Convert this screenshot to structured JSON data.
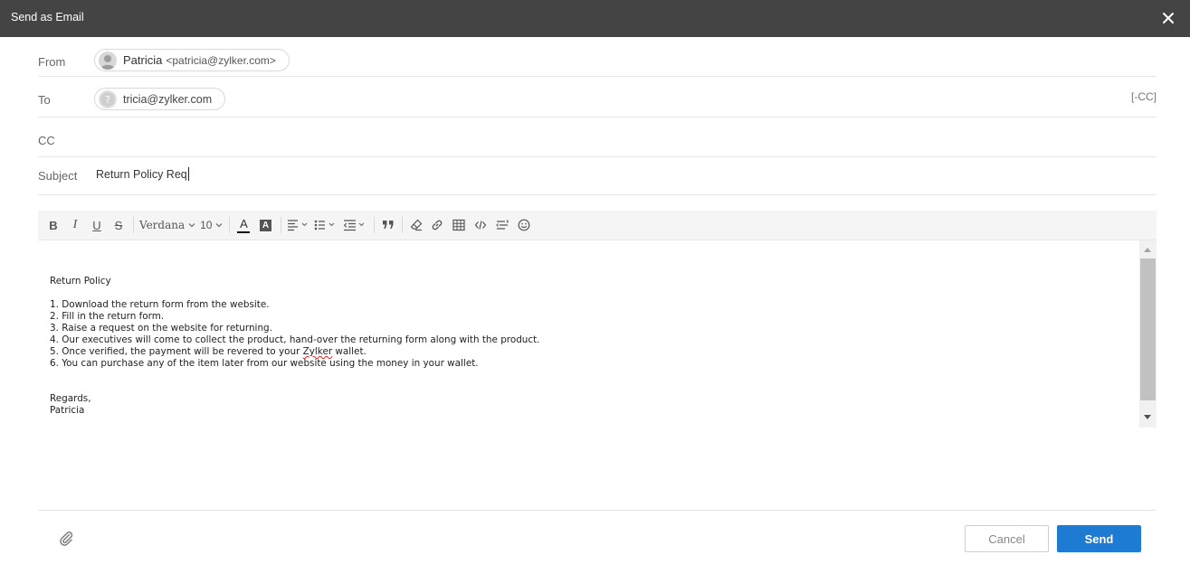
{
  "dialog": {
    "title": "Send as Email",
    "close_icon": "close-icon"
  },
  "from": {
    "label": "From",
    "name": "Patricia",
    "email": "<patricia@zylker.com>"
  },
  "to": {
    "label": "To",
    "email": "tricia@zylker.com",
    "cc_toggle": "[-CC]"
  },
  "cc": {
    "label": "CC"
  },
  "subject": {
    "label": "Subject",
    "value": "Return Policy Req"
  },
  "toolbar": {
    "bold": "B",
    "italic": "I",
    "underline": "U",
    "strikethrough": "S",
    "font_family": "Verdana",
    "font_size": "10",
    "text_color_letter": "A",
    "bg_color_letter": "A",
    "icons": [
      "bold-icon",
      "italic-icon",
      "underline-icon",
      "strikethrough-icon",
      "font-family-select",
      "font-size-select",
      "text-color-icon",
      "background-color-icon",
      "align-icon",
      "list-icon",
      "indent-icon",
      "quote-icon",
      "clear-format-icon",
      "link-icon",
      "table-icon",
      "code-icon",
      "text-direction-icon",
      "emoji-icon"
    ]
  },
  "body": {
    "heading": "Return Policy",
    "lines": [
      "1. Download the return form from the website.",
      "2. Fill in the return form.",
      "3. Raise a request on the website for returning.",
      "4. Our executives will come to collect the product, hand-over the returning form along with the product.",
      "5. Once verified, the payment will be revered to your ",
      "6. You can purchase any of the item later from our website using the money in your wallet."
    ],
    "misspelled_word": "Zylker",
    "line5_tail": " wallet.",
    "regards": "Regards,",
    "signature": "Patricia"
  },
  "footer": {
    "attach_icon": "paperclip-icon",
    "cancel_label": "Cancel",
    "send_label": "Send"
  },
  "colors": {
    "titlebar": "#444444",
    "send_button": "#1d7bd4",
    "spell_underline": "#e02020"
  }
}
